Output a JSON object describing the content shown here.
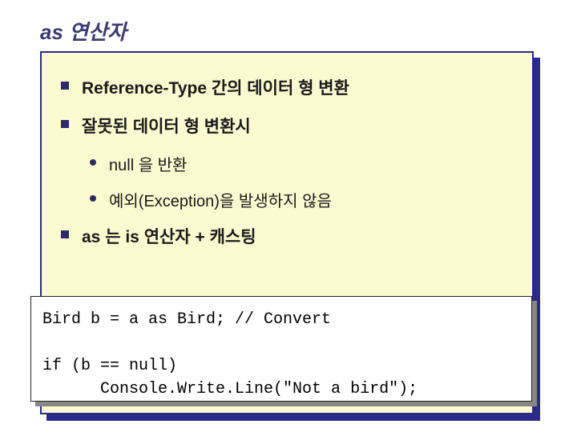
{
  "title": "as 연산자",
  "bullets": {
    "b1_a": "Reference-Type 간의 데이터 형 변환",
    "b1_b": "잘못된 데이터 형 변환시",
    "b2_a": "null 을 반환",
    "b2_b": "예외(Exception)을 발생하지 않음",
    "b1_c": "as 는  is 연산자 + 캐스팅"
  },
  "code": {
    "line1": "Bird b = a as Bird; // Convert",
    "line2": "",
    "line3": "if (b == null)",
    "line4": "      Console.Write.Line(\"Not a bird\");"
  }
}
